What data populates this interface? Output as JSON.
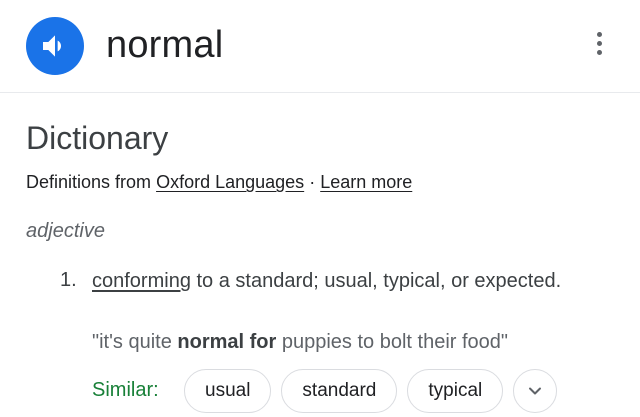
{
  "header": {
    "headword": "normal",
    "speaker_icon": "volume-up-icon",
    "menu_icon": "more-vert-icon",
    "accent_color": "#1a73e8"
  },
  "dictionary": {
    "title": "Dictionary",
    "source_prefix": "Definitions from",
    "source_link": "Oxford Languages",
    "separator": "·",
    "learn_more": "Learn more",
    "part_of_speech": "adjective",
    "senses": [
      {
        "number": "1.",
        "linked_word": "conforming",
        "definition_rest": " to a standard; usual, typical, or expected.",
        "example_open": "\"it's quite ",
        "example_bold": "normal for",
        "example_close": " puppies to bolt their food\""
      }
    ],
    "similar": {
      "label": "Similar:",
      "label_color": "#188038",
      "chips": [
        "usual",
        "standard",
        "typical"
      ],
      "expand_icon": "chevron-down-icon"
    }
  }
}
